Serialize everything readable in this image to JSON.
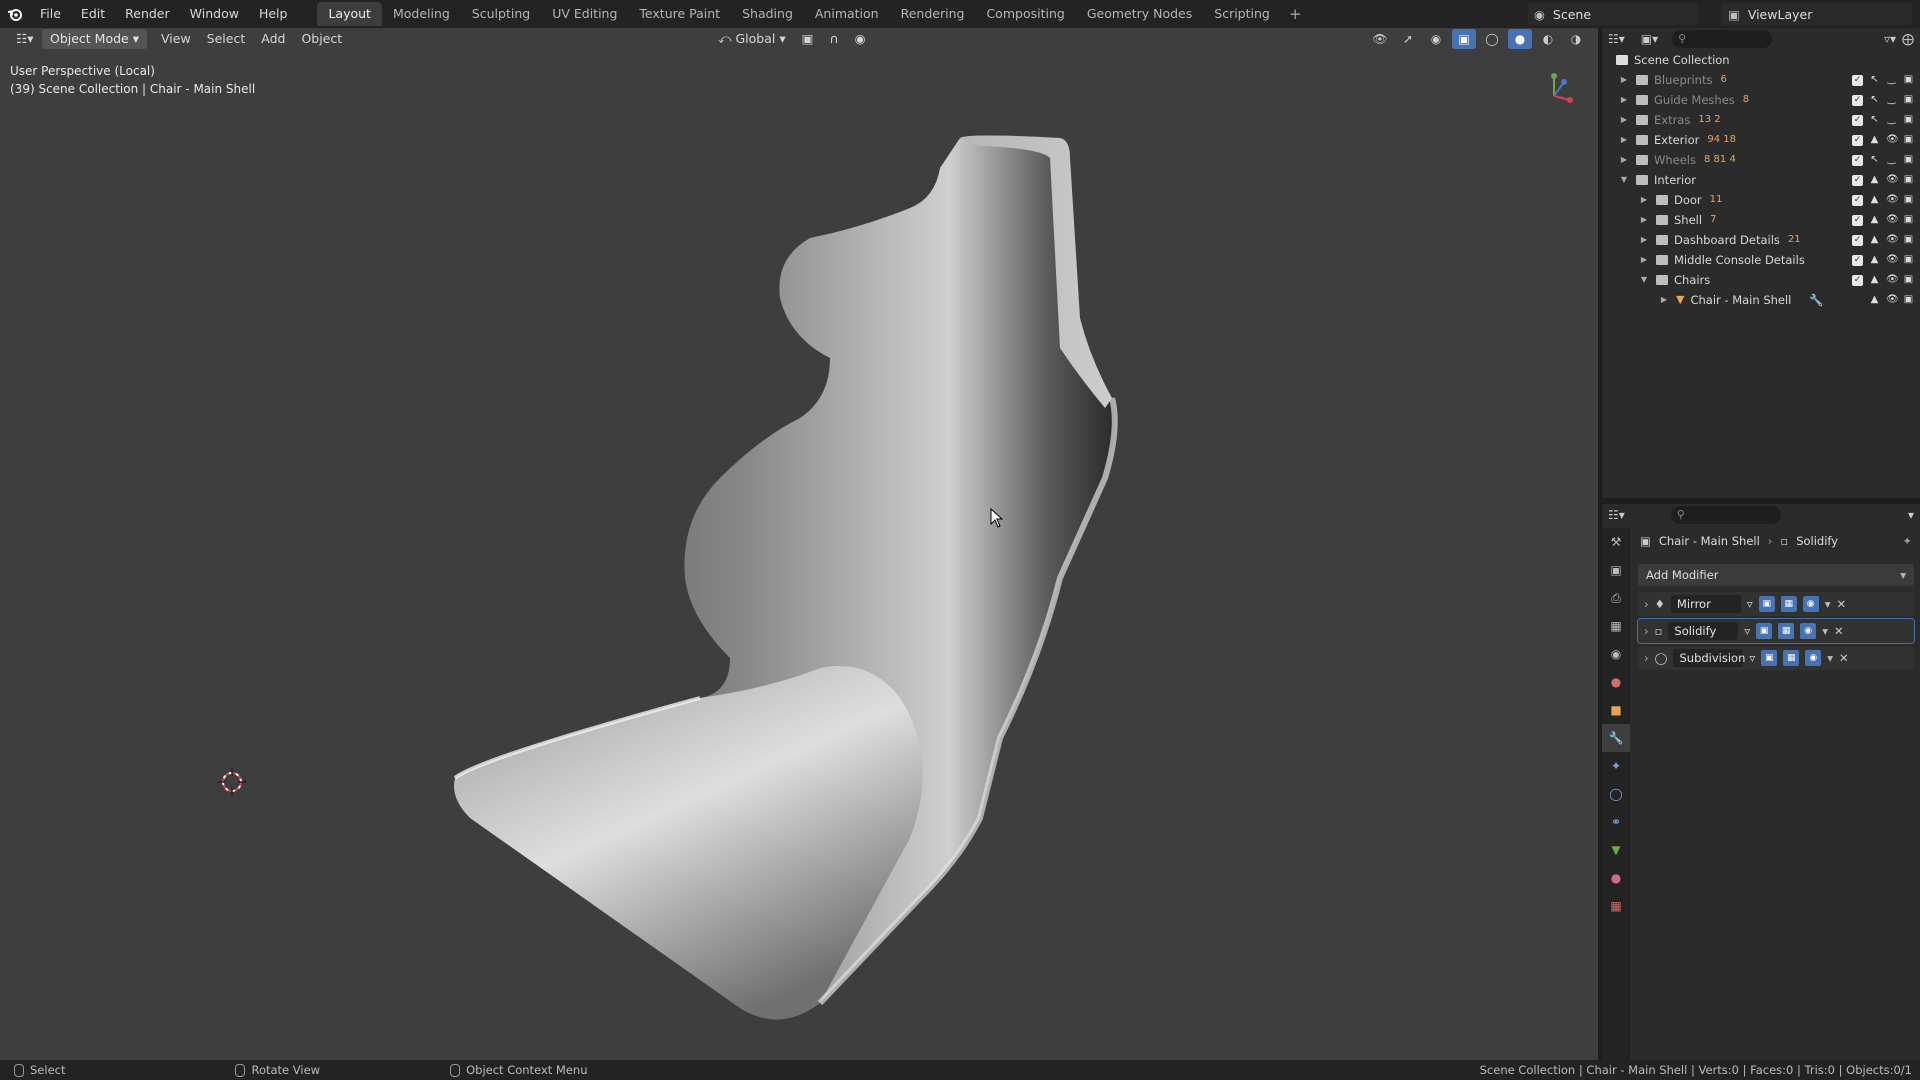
{
  "menu": {
    "items": [
      "File",
      "Edit",
      "Render",
      "Window",
      "Help"
    ]
  },
  "workspaces": {
    "tabs": [
      "Layout",
      "Modeling",
      "Sculpting",
      "UV Editing",
      "Texture Paint",
      "Shading",
      "Animation",
      "Rendering",
      "Compositing",
      "Geometry Nodes",
      "Scripting"
    ],
    "add": "+"
  },
  "scene": {
    "name": "Scene",
    "view_layer": "ViewLayer"
  },
  "viewport": {
    "mode": "Object Mode",
    "menus": [
      "View",
      "Select",
      "Add",
      "Object"
    ],
    "transform": "Global",
    "info_line1": "User Perspective (Local)",
    "info_line2": "(39) Scene Collection | Chair - Main Shell"
  },
  "outliner": {
    "root": "Scene Collection",
    "rows": [
      {
        "label": "Blueprints",
        "count": "6"
      },
      {
        "label": "Guide Meshes",
        "count": "8"
      },
      {
        "label": "Extras",
        "count": "13  2"
      },
      {
        "label": "Exterior",
        "count": "94 18"
      },
      {
        "label": "Wheels",
        "count": "8 81 4"
      },
      {
        "label": "Interior",
        "count": ""
      },
      {
        "label": "Door",
        "count": "11"
      },
      {
        "label": "Shell",
        "count": "7"
      },
      {
        "label": "Dashboard Details",
        "count": "21"
      },
      {
        "label": "Middle Console Details",
        "count": ""
      },
      {
        "label": "Chairs",
        "count": ""
      },
      {
        "label": "Chair - Main Shell",
        "count": ""
      }
    ]
  },
  "properties": {
    "object": "Chair - Main Shell",
    "modifier": "Solidify",
    "add_modifier": "Add Modifier",
    "modifiers": [
      "Mirror",
      "Solidify",
      "Subdivision"
    ]
  },
  "status": {
    "select": "Select",
    "rotate": "Rotate View",
    "context": "Object Context Menu",
    "stats": "Scene Collection | Chair - Main Shell | Verts:0 | Faces:0 | Tris:0 | Objects:0/1"
  },
  "colors": {
    "accent": "#4772b3",
    "viewport_bg": "#3e3e3e",
    "panel_bg": "#2b2b2b"
  }
}
